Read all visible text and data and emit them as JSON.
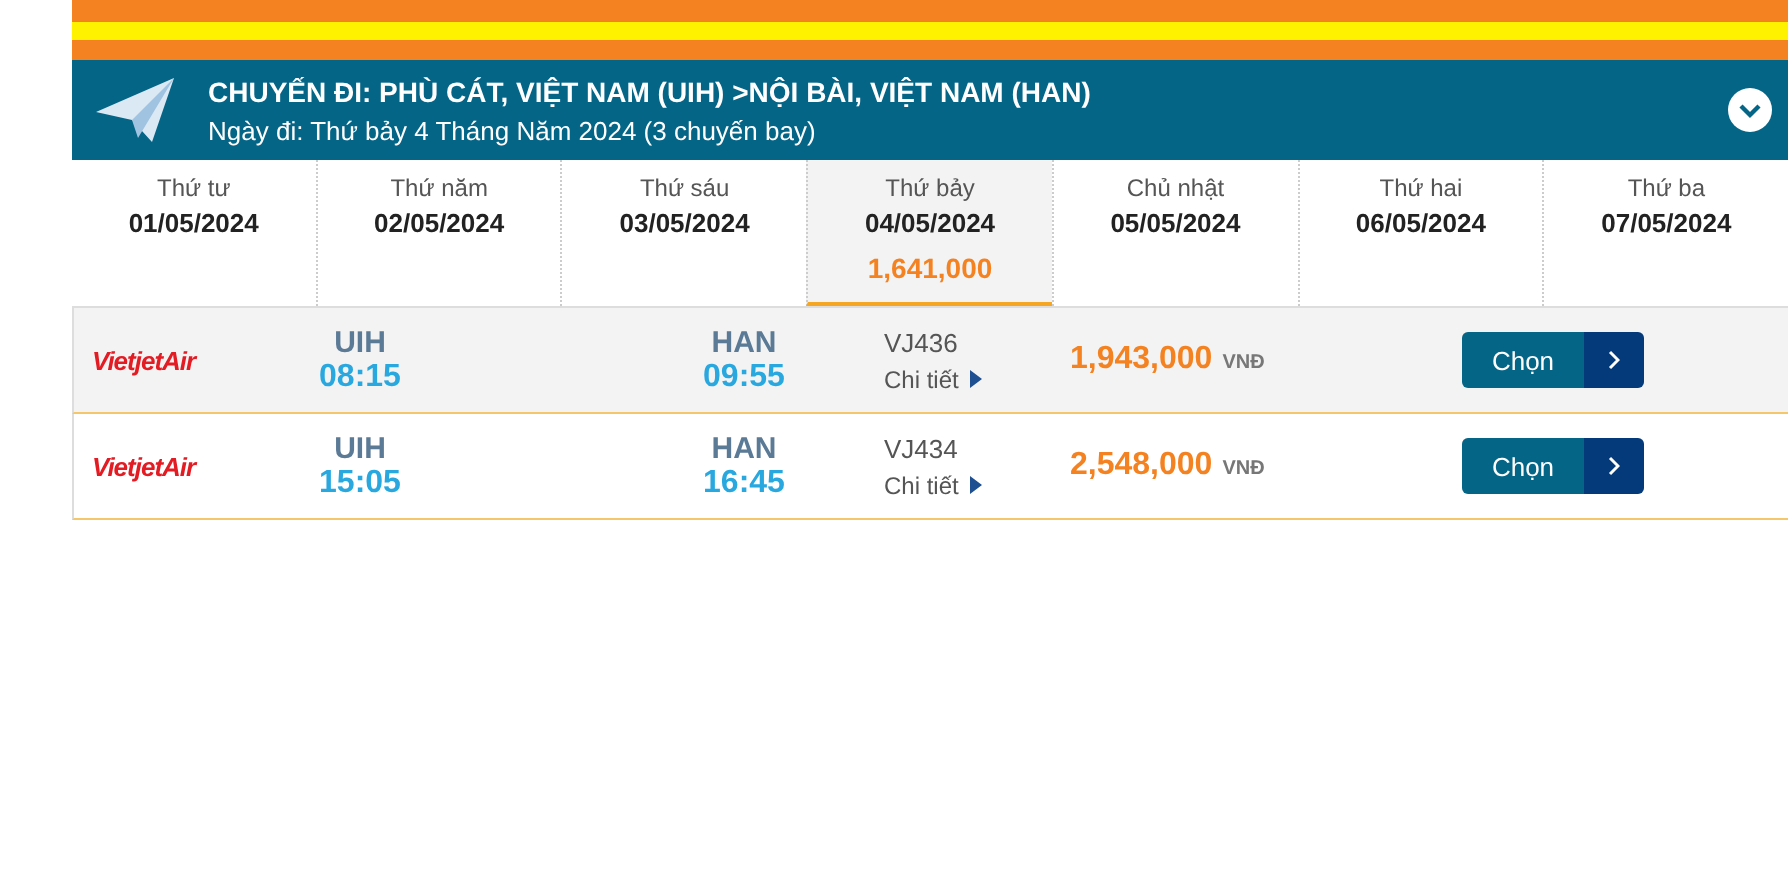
{
  "header": {
    "title": "CHUYẾN ĐI: PHÙ CÁT, VIỆT NAM (UIH) >NỘI BÀI, VIỆT NAM (HAN)",
    "subtitle": "Ngày đi: Thứ bảy 4 Tháng Năm 2024 (3 chuyến bay)"
  },
  "dates": [
    {
      "day": "Thứ tư",
      "date": "01/05/2024",
      "selected": false
    },
    {
      "day": "Thứ năm",
      "date": "02/05/2024",
      "selected": false
    },
    {
      "day": "Thứ sáu",
      "date": "03/05/2024",
      "selected": false
    },
    {
      "day": "Thứ bảy",
      "date": "04/05/2024",
      "price": "1,641,000",
      "selected": true
    },
    {
      "day": "Chủ nhật",
      "date": "05/05/2024",
      "selected": false
    },
    {
      "day": "Thứ hai",
      "date": "06/05/2024",
      "selected": false
    },
    {
      "day": "Thứ ba",
      "date": "07/05/2024",
      "selected": false
    }
  ],
  "flights": [
    {
      "airline": "VietjetAir",
      "from_code": "UIH",
      "from_time": "08:15",
      "to_code": "HAN",
      "to_time": "09:55",
      "flight_no": "VJ436",
      "details": "Chi tiết",
      "price": "1,943,000",
      "currency": "VNĐ",
      "button": "Chọn",
      "highlighted": true
    },
    {
      "airline": "VietjetAir",
      "from_code": "UIH",
      "from_time": "15:05",
      "to_code": "HAN",
      "to_time": "16:45",
      "flight_no": "VJ434",
      "details": "Chi tiết",
      "price": "2,548,000",
      "currency": "VNĐ",
      "button": "Chọn",
      "highlighted": false
    }
  ]
}
